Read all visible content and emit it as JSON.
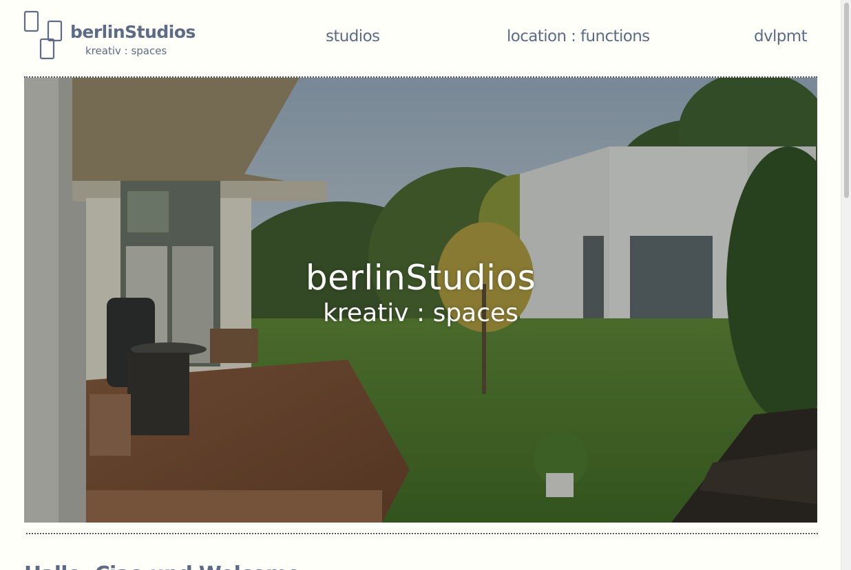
{
  "brand": {
    "name": "berlinStudios",
    "tagline": "kreativ : spaces",
    "color": "#5e6b87"
  },
  "nav": {
    "items": [
      {
        "label": "studios"
      },
      {
        "label": "location : functions"
      },
      {
        "label": "dvlpmt"
      }
    ]
  },
  "hero": {
    "title": "berlinStudios",
    "subtitle": "kreativ : spaces"
  },
  "content": {
    "heading": "Hallo, Ciao und Welcome"
  }
}
